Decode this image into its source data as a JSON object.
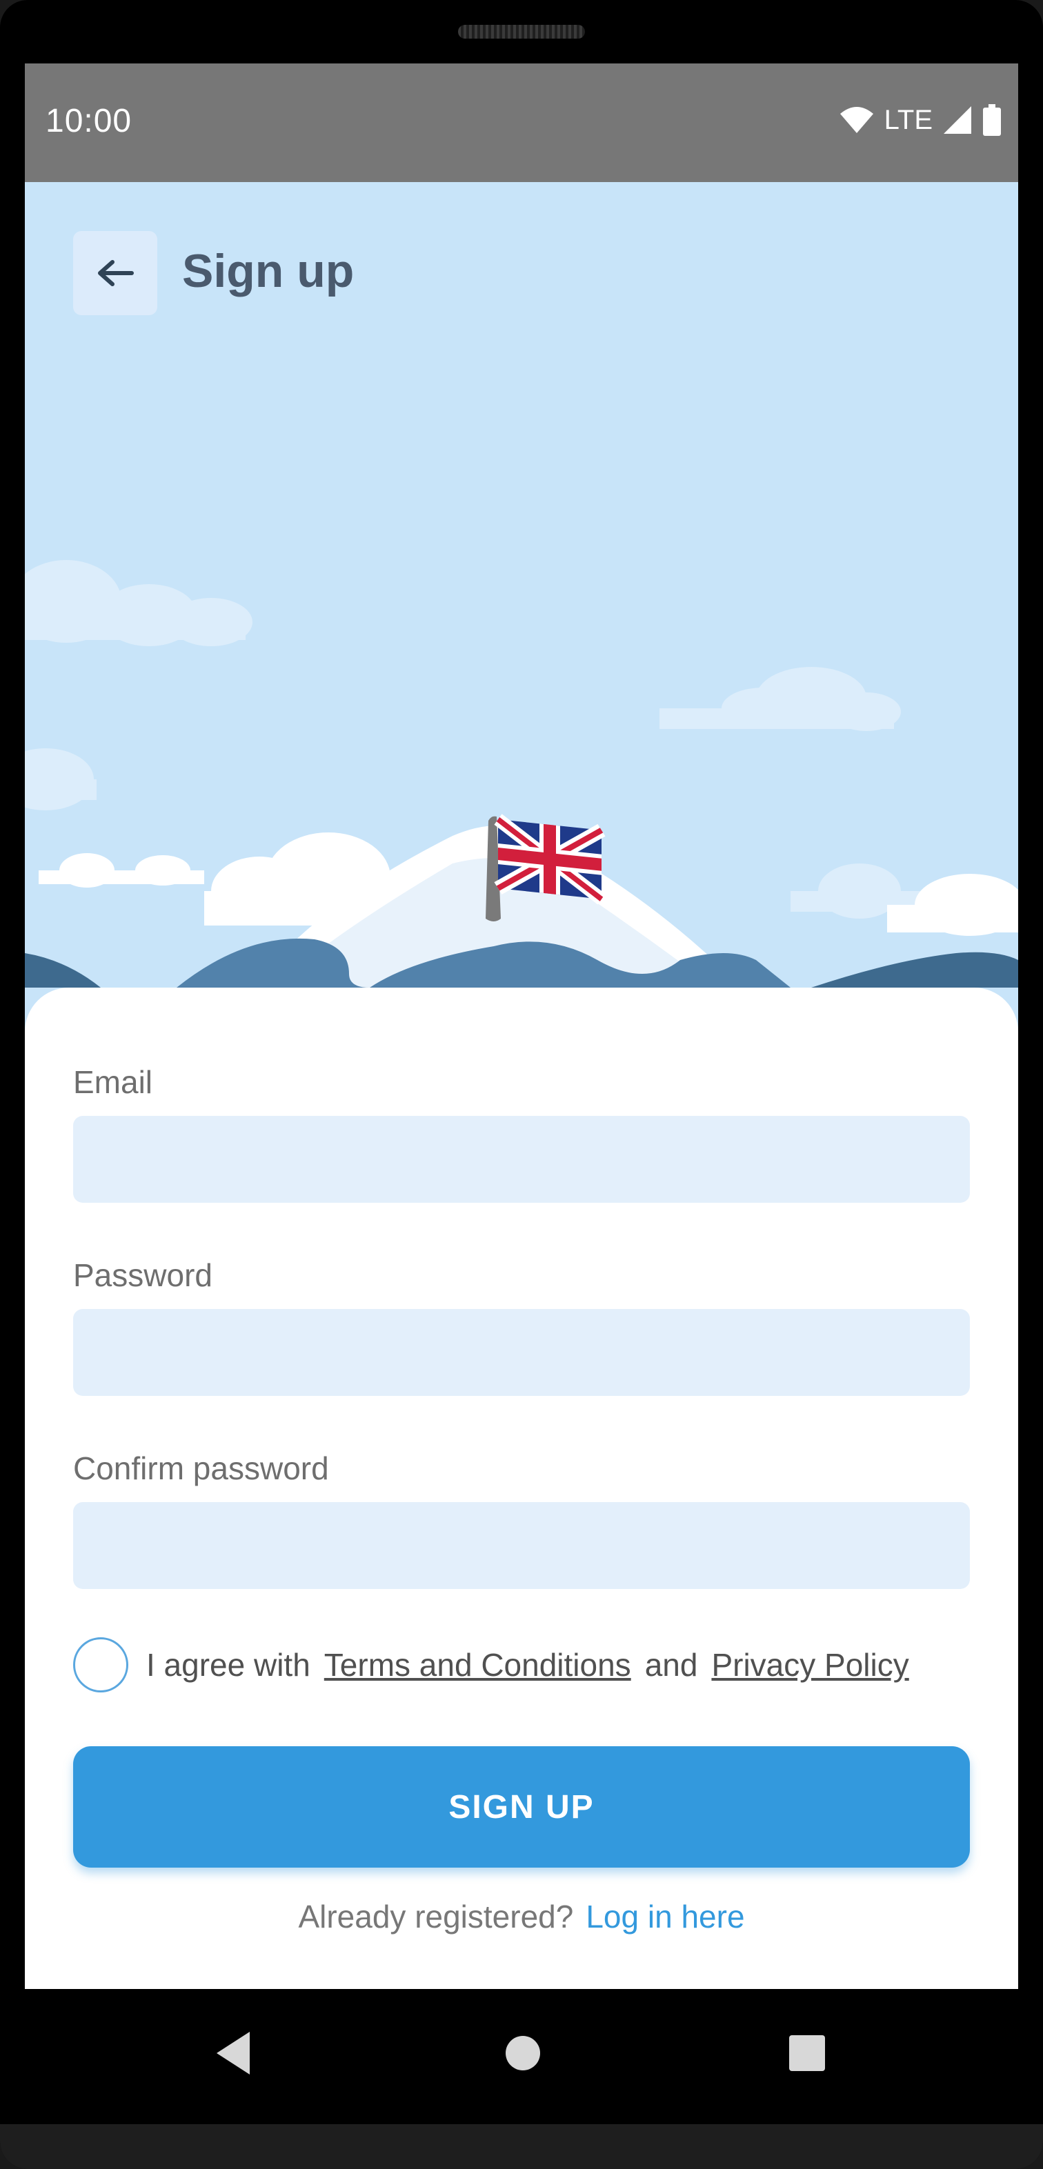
{
  "status_bar": {
    "time": "10:00",
    "network": "LTE"
  },
  "header": {
    "back_icon": "arrow-left-icon",
    "title": "Sign up"
  },
  "form": {
    "email": {
      "label": "Email",
      "value": "",
      "placeholder": ""
    },
    "password": {
      "label": "Password",
      "value": "",
      "placeholder": ""
    },
    "confirm_password": {
      "label": "Confirm password",
      "value": "",
      "placeholder": ""
    },
    "agreement": {
      "checked": false,
      "prefix": "I agree with",
      "terms_link": "Terms and Conditions",
      "joiner": "and",
      "privacy_link": "Privacy Policy"
    },
    "submit_label": "SIGN UP",
    "login_prompt": "Already registered?",
    "login_link": "Log in here"
  },
  "illustration": {
    "flag": "union-jack-icon",
    "scene": "mountain-illustration"
  },
  "nav_bar": {
    "back_icon": "nav-back-icon",
    "home_icon": "nav-home-icon",
    "recents_icon": "nav-recents-icon"
  },
  "colors": {
    "sky": "#c8e4f9",
    "accent": "#3399dd",
    "input_bg": "#e3effb",
    "status_bar": "#777777"
  }
}
